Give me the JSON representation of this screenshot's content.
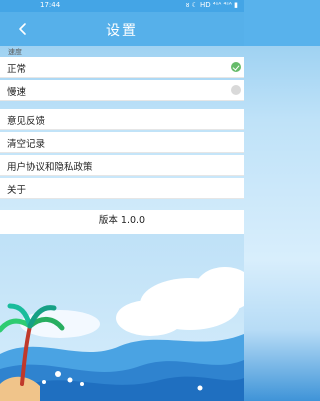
{
  "status_bar": {
    "time": "17:44",
    "indicators": "ᴕ ☾ HD ⁴ˢᴬ ⁴ˢᴬ ▮"
  },
  "header": {
    "back_icon": "chevron-left-icon",
    "back_glyph": "<",
    "title": "设置"
  },
  "speed_section": {
    "label": "速度",
    "options": [
      {
        "label": "正常",
        "selected": true
      },
      {
        "label": "慢速",
        "selected": false
      }
    ]
  },
  "menu": {
    "items": [
      {
        "label": "意见反馈"
      },
      {
        "label": "清空记录"
      },
      {
        "label": "用户协议和隐私政策"
      },
      {
        "label": "关于"
      }
    ]
  },
  "version": {
    "text": "版本 1.0.0"
  },
  "colors": {
    "header": "#56b0ea",
    "status_bar": "#44a5e6",
    "selected": "#66bb6a",
    "unselected": "#d9d9d9"
  }
}
